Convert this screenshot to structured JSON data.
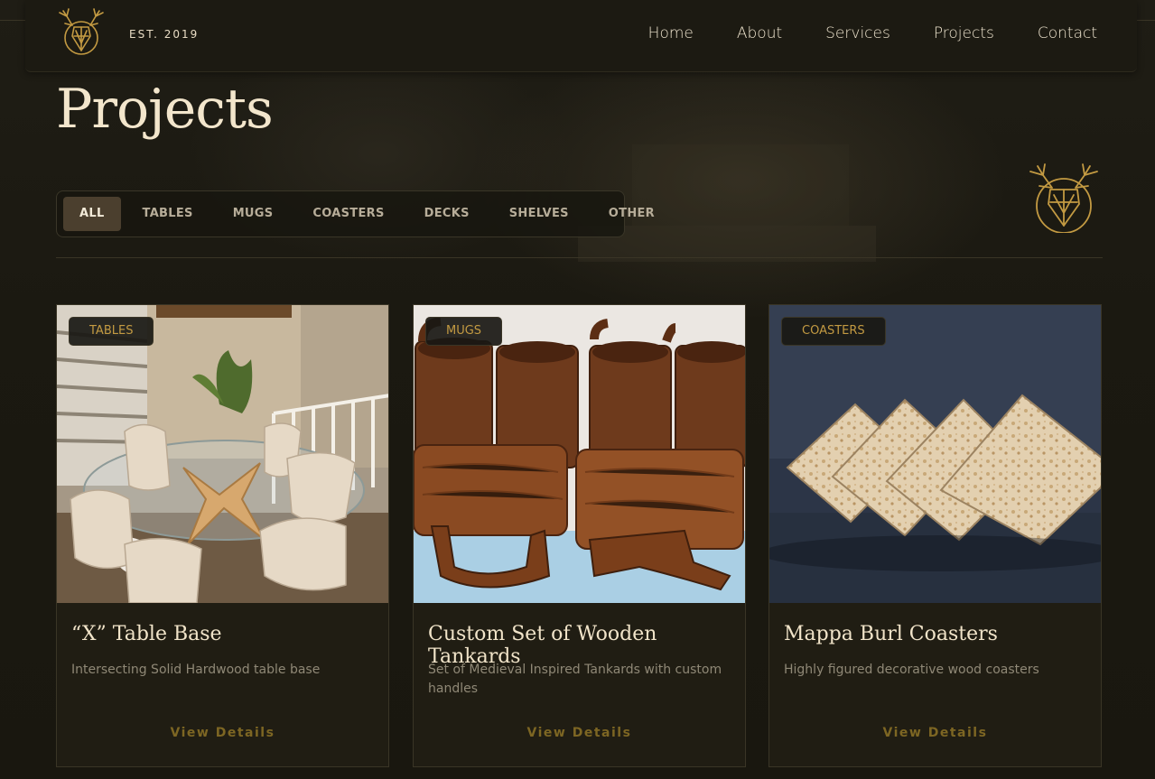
{
  "header": {
    "tagline": "EST. 2019",
    "nav": [
      "Home",
      "About",
      "Services",
      "Projects",
      "Contact"
    ]
  },
  "page": {
    "title": "Projects"
  },
  "filters": {
    "items": [
      "ALL",
      "TABLES",
      "MUGS",
      "COASTERS",
      "DECKS",
      "SHELVES",
      "OTHER"
    ],
    "active": "ALL"
  },
  "projects": [
    {
      "category": "TABLES",
      "title": "“X” Table Base",
      "description": "Intersecting Solid Hardwood table base",
      "cta": "View Details"
    },
    {
      "category": "MUGS",
      "title": "Custom Set of Wooden Tankards",
      "description": "Set of Medieval Inspired Tankards with custom handles",
      "cta": "View Details"
    },
    {
      "category": "COASTERS",
      "title": "Mappa Burl Coasters",
      "description": "Highly figured decorative wood coasters",
      "cta": "View Details"
    }
  ],
  "colors": {
    "background": "#1a1810",
    "accent": "#c39a42",
    "cta": "#7d6623",
    "active_filter": "#4b3f2e"
  }
}
